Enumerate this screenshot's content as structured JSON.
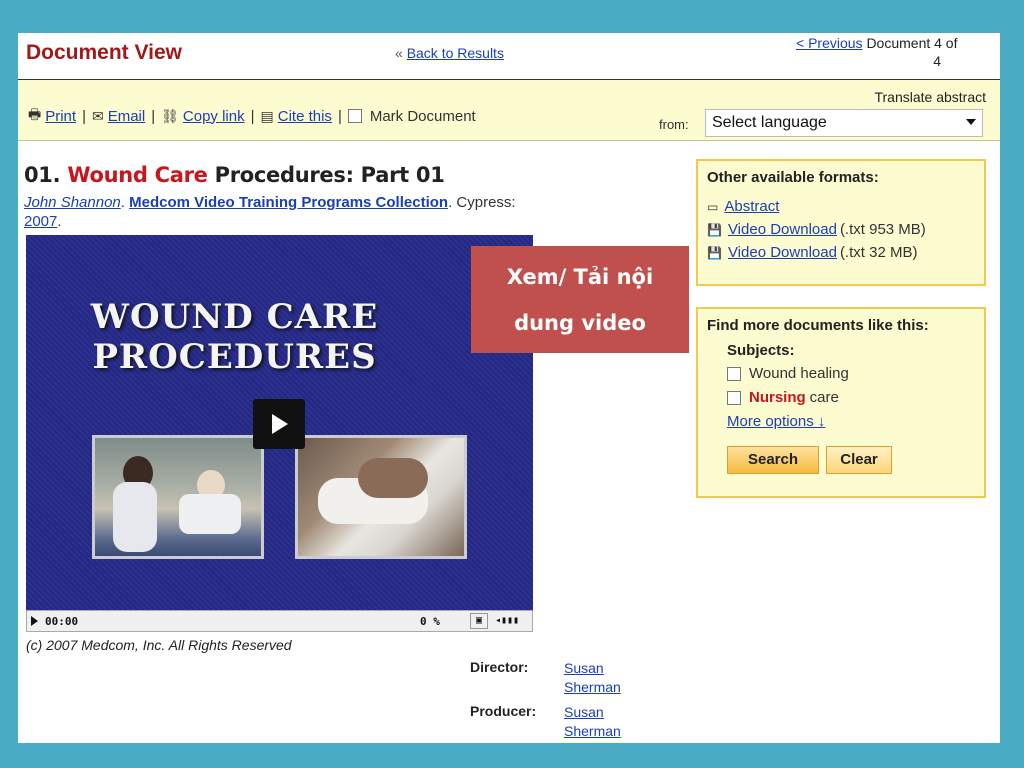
{
  "header": {
    "title": "Document View",
    "back_prefix": "«",
    "back_link": "Back to Results",
    "previous_link": "< Previous",
    "doc_count": "Document 4 of",
    "doc_total": "4"
  },
  "toolbar": {
    "print": "Print",
    "email": "Email",
    "copy_link": "Copy link",
    "cite": "Cite this",
    "mark": "Mark Document",
    "translate_label": "Translate abstract",
    "from_label": "from:",
    "language_select": "Select language"
  },
  "record": {
    "number": "01.",
    "title_hl": "Wound Care",
    "title_rest": "Procedures: Part 01",
    "author": "John Shannon",
    "collection": "Medcom Video Training Programs Collection",
    "place": "Cypress:",
    "year": "2007"
  },
  "video": {
    "title_line1": "WOUND CARE",
    "title_line2": "PROCEDURES",
    "time": "00:00",
    "percent": "0 %",
    "copyright": "(c) 2007 Medcom, Inc. All Rights Reserved"
  },
  "credits": [
    {
      "label": "Director:",
      "name": "Susan Sherman"
    },
    {
      "label": "Producer:",
      "name": "Susan Sherman"
    }
  ],
  "overlay": {
    "line1": "Xem/ Tải nội",
    "line2": "dung video"
  },
  "formats": {
    "heading": "Other available formats:",
    "items": [
      {
        "link": "Abstract",
        "extra": ""
      },
      {
        "link": "Video Download",
        "extra": "(.txt 953 MB)"
      },
      {
        "link": "Video Download",
        "extra": "(.txt 32 MB)"
      }
    ]
  },
  "find_more": {
    "heading": "Find more documents like this:",
    "subjects_label": "Subjects:",
    "subject1": "Wound healing",
    "subject2_hl": "Nursing",
    "subject2_rest": "care",
    "more_options": "More options ↓",
    "search_btn": "Search",
    "clear_btn": "Clear"
  },
  "colors": {
    "background": "#4aabc5",
    "brand_red": "#a0191b",
    "link_blue": "#1a3fb5",
    "toolbar_yellow": "#fdfbd0",
    "overlay_red": "#c0504d"
  }
}
